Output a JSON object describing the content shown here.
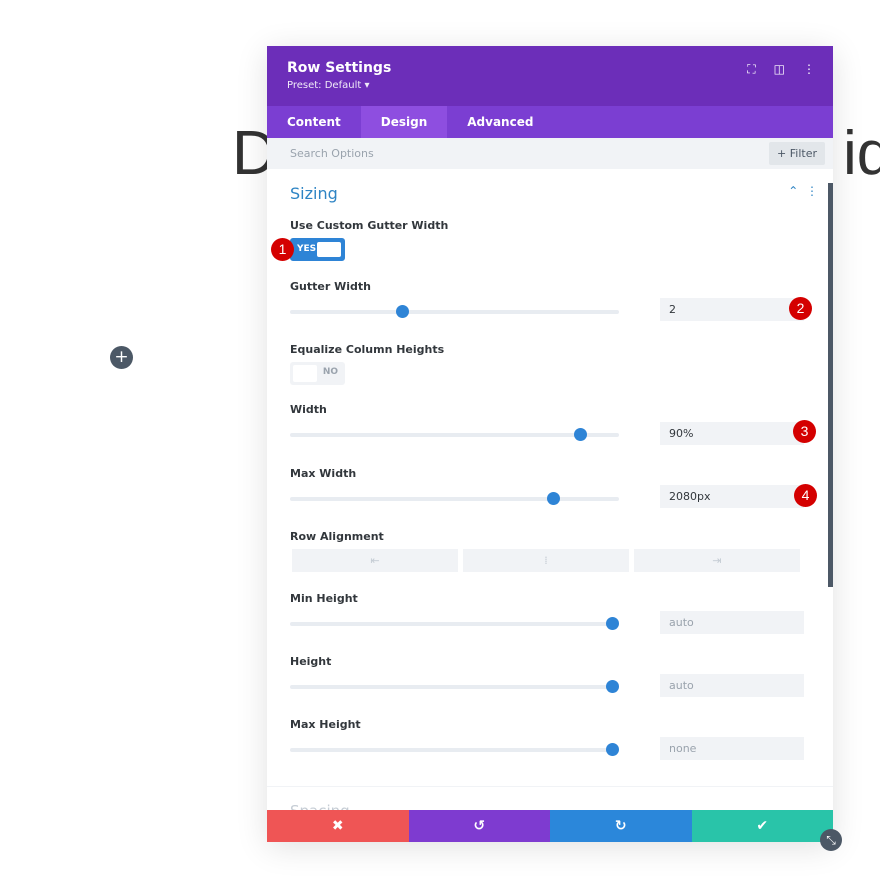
{
  "background": {
    "text_left": "D",
    "text_right": "iq"
  },
  "header": {
    "title": "Row Settings",
    "preset": "Preset: Default ▾"
  },
  "tabs": [
    {
      "label": "Content"
    },
    {
      "label": "Design",
      "active": true
    },
    {
      "label": "Advanced"
    }
  ],
  "search": {
    "placeholder": "Search Options",
    "filter_label": "+ Filter"
  },
  "section": {
    "title": "Sizing",
    "collapsed_next": "Spacing"
  },
  "fields": {
    "gutter_toggle": {
      "label": "Use Custom Gutter Width",
      "value": "YES"
    },
    "gutter_width": {
      "label": "Gutter Width",
      "value": "2",
      "slider_percent": 34
    },
    "equalize": {
      "label": "Equalize Column Heights",
      "value": "NO"
    },
    "width": {
      "label": "Width",
      "value": "90%",
      "slider_percent": 88
    },
    "max_width": {
      "label": "Max Width",
      "value": "2080px",
      "slider_percent": 80
    },
    "row_alignment": {
      "label": "Row Alignment",
      "options": [
        "left",
        "center",
        "right"
      ]
    },
    "min_height": {
      "label": "Min Height",
      "value": "auto",
      "slider_percent": 98
    },
    "height": {
      "label": "Height",
      "value": "auto",
      "slider_percent": 98
    },
    "max_height": {
      "label": "Max Height",
      "value": "none",
      "slider_percent": 98
    }
  },
  "badges": [
    "1",
    "2",
    "3",
    "4"
  ],
  "footer": {
    "cancel": "✖",
    "undo": "↺",
    "redo": "↻",
    "save": "✔"
  },
  "colors": {
    "header": "#6c2eb9",
    "tabs": "#7b3ed2",
    "accent": "#2e84d6",
    "cancel": "#ef5555",
    "undo": "#7e3bd0",
    "redo": "#2b87da",
    "save": "#29c4a9",
    "badge": "#d40000"
  }
}
